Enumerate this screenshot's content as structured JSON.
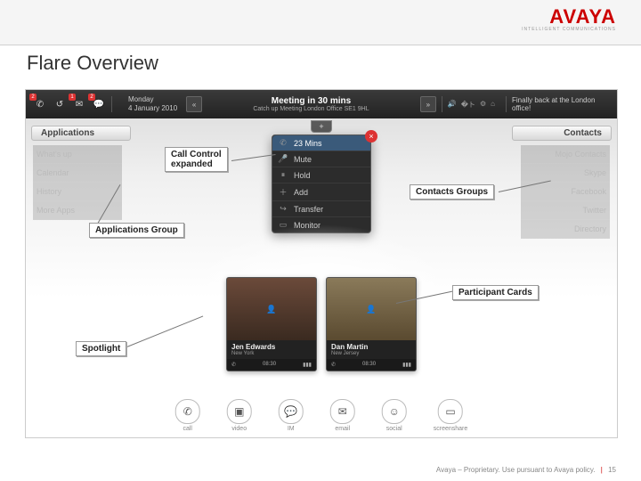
{
  "slide": {
    "title": "Flare Overview"
  },
  "brand": {
    "name": "AVAYA",
    "tagline": "INTELLIGENT COMMUNICATIONS"
  },
  "appbar": {
    "day": "Monday",
    "date": "4 January 2010",
    "meeting_title": "Meeting in 30 mins",
    "meeting_loc": "Catch up Meeting London Office SE1 9HL",
    "status_msg": "Finally back at the London office!",
    "badges": {
      "calls": "2",
      "mail": "1",
      "im": "2"
    }
  },
  "panels": {
    "apps_header": "Applications",
    "contacts_header": "Contacts",
    "apps": [
      "What's up",
      "Calendar",
      "History",
      "More Apps"
    ],
    "contacts": [
      "Mojo Contacts",
      "Skype",
      "Facebook",
      "Twitter",
      "Directory"
    ]
  },
  "call_control": {
    "duration": "23 Mins",
    "items": [
      "Mute",
      "Hold",
      "Add",
      "Transfer",
      "Monitor"
    ]
  },
  "participants": [
    {
      "name": "Jen Edwards",
      "loc": "New York",
      "time": "08:30"
    },
    {
      "name": "Dan Martin",
      "loc": "New Jersey",
      "time": "08:30"
    }
  ],
  "dock": [
    {
      "label": "call",
      "glyph": "✆"
    },
    {
      "label": "video",
      "glyph": "▣"
    },
    {
      "label": "IM",
      "glyph": "✉"
    },
    {
      "label": "email",
      "glyph": "✉"
    },
    {
      "label": "social",
      "glyph": "☺"
    },
    {
      "label": "screenshare",
      "glyph": "▭"
    }
  ],
  "callouts": {
    "call_control": "Call Control\nexpanded",
    "contacts_groups": "Contacts Groups",
    "applications_group": "Applications Group",
    "participant_cards": "Participant Cards",
    "spotlight": "Spotlight"
  },
  "footer": {
    "text": "Avaya – Proprietary. Use pursuant to Avaya policy.",
    "page": "15"
  }
}
